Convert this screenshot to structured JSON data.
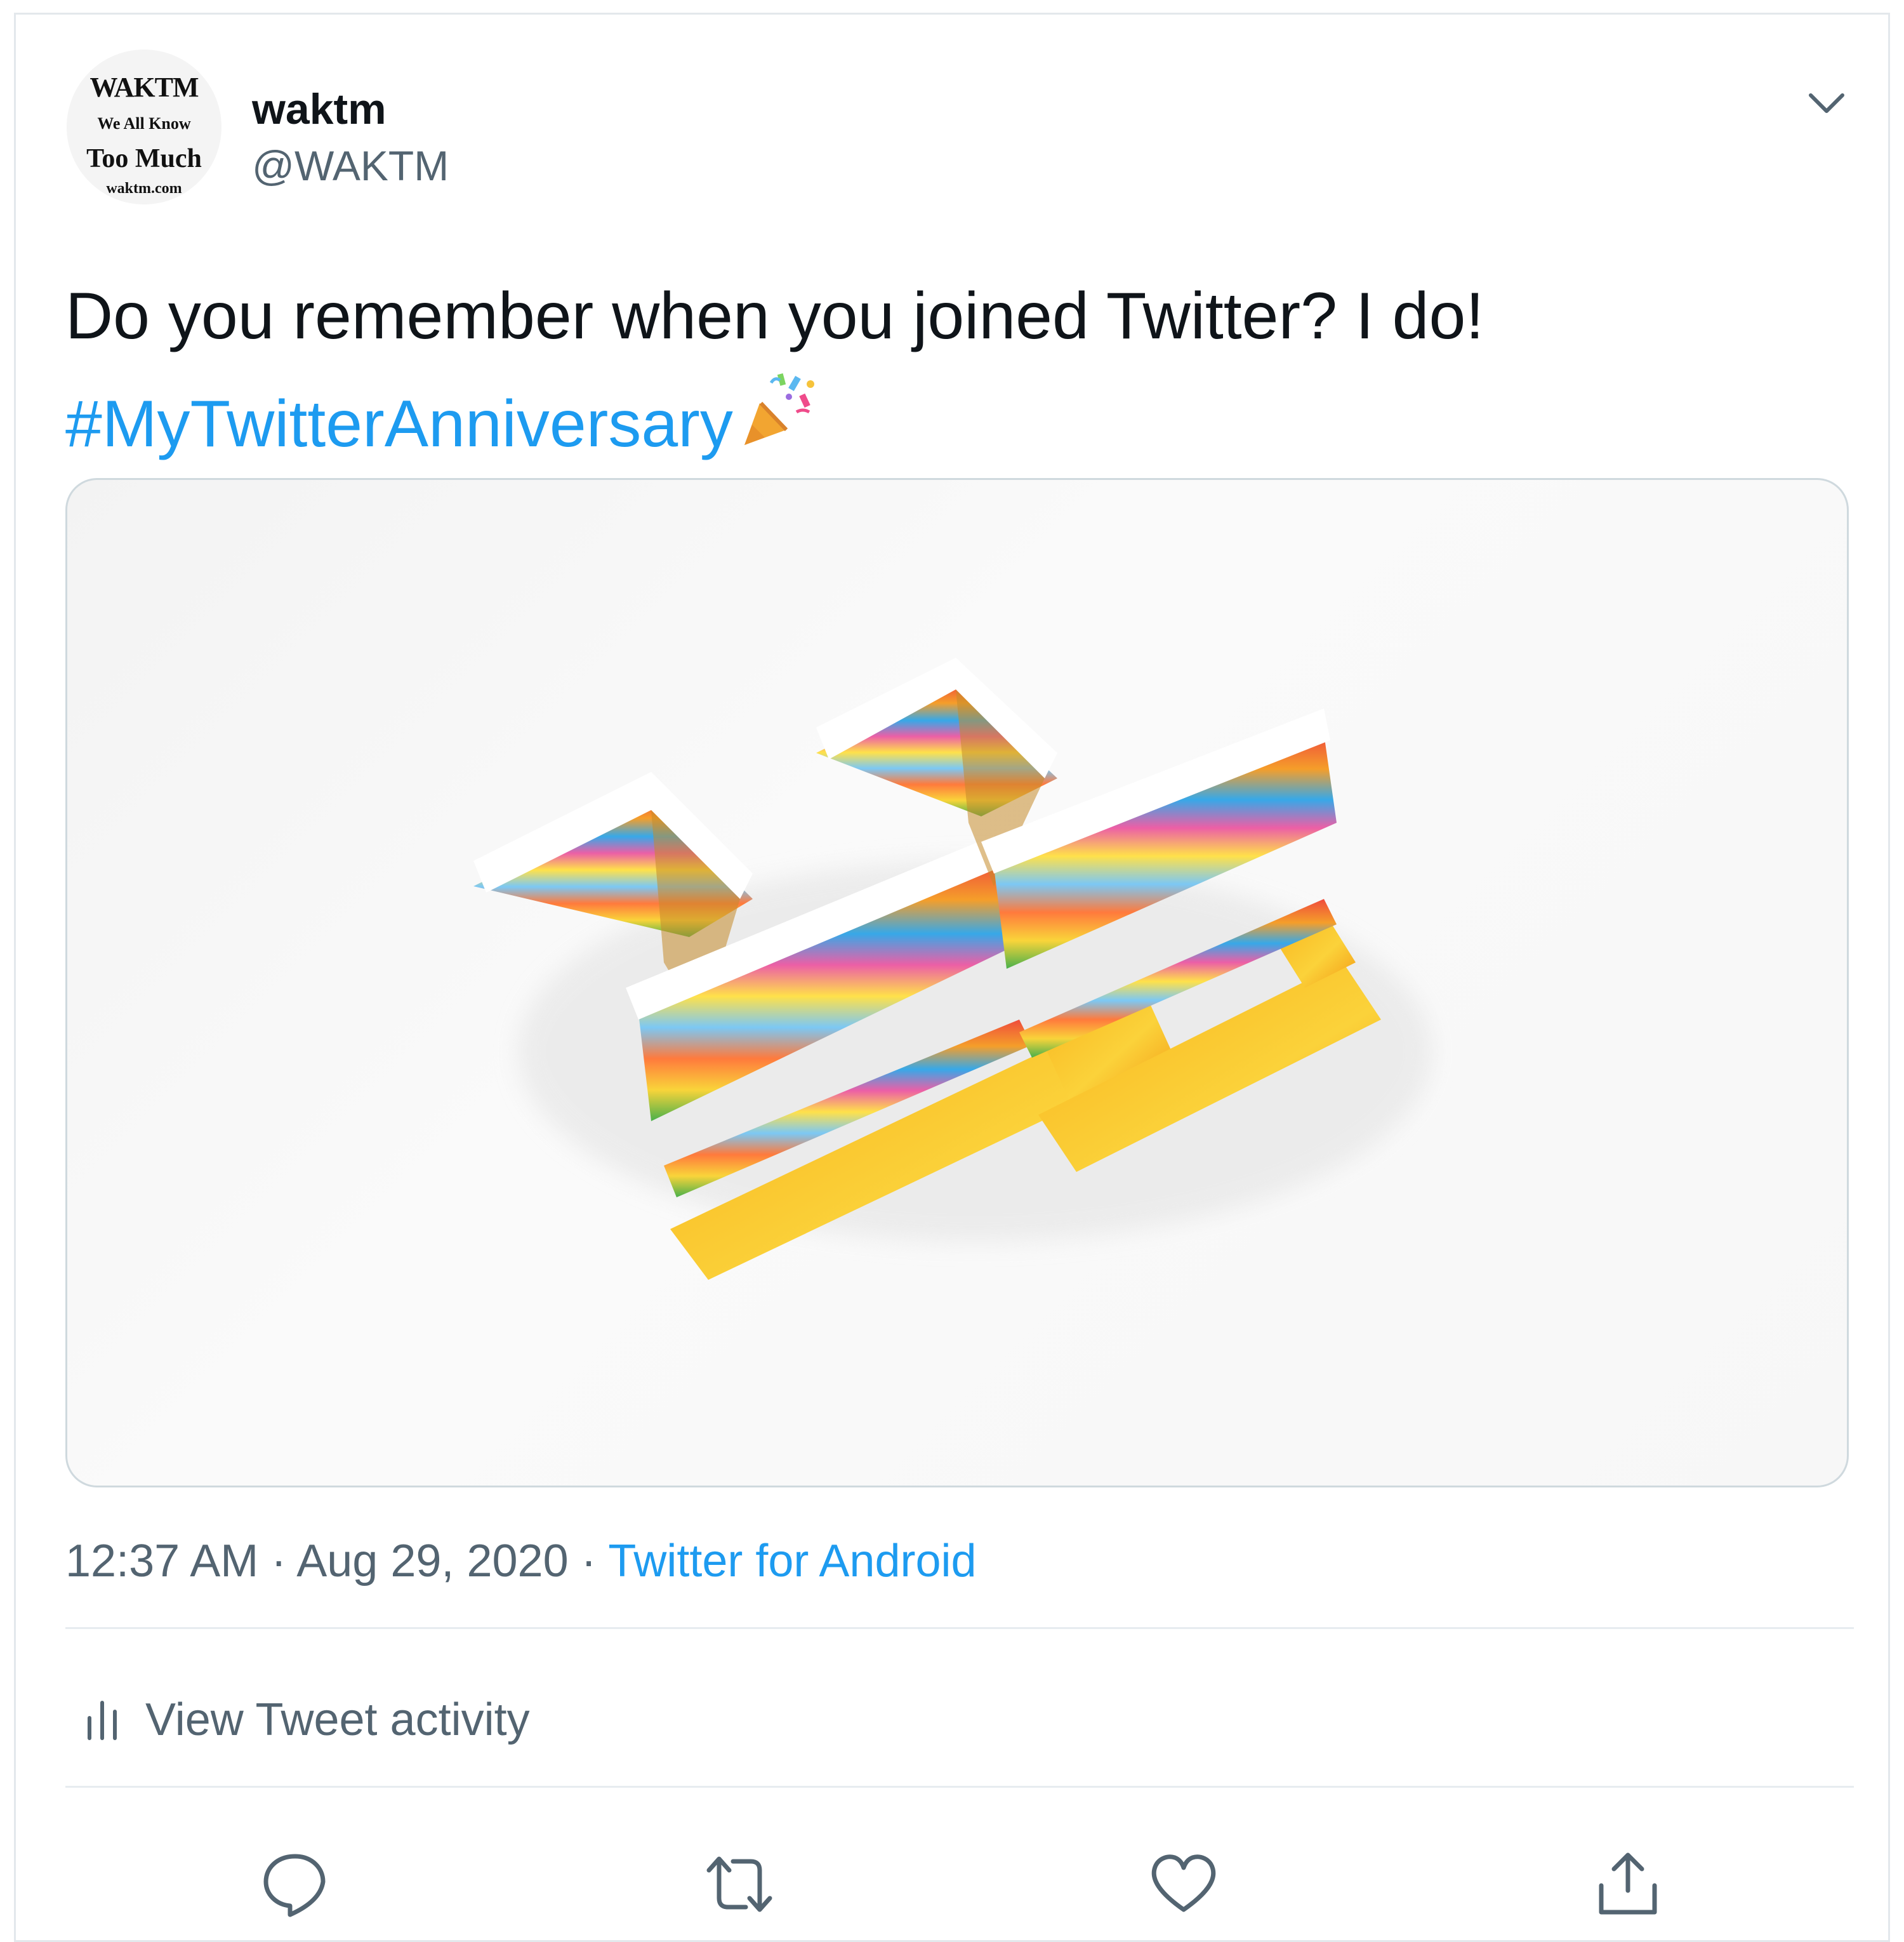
{
  "author": {
    "display_name": "waktm",
    "handle": "@WAKTM",
    "avatar_text": {
      "line1": "WAKTM",
      "line2": "We All Know",
      "line3": "Too Much",
      "line4": "waktm.com"
    }
  },
  "tweet": {
    "text": "Do you remember when you joined Twitter? I do!",
    "hashtag": "#MyTwitterAnniversary",
    "emoji_icon": "party-popper-icon"
  },
  "meta": {
    "time": "12:37 AM",
    "separator": " · ",
    "date": "Aug 29, 2020",
    "source": "Twitter for Android"
  },
  "activity": {
    "label": "View Tweet activity",
    "icon": "bar-chart-icon"
  },
  "actions": [
    {
      "name": "reply",
      "icon": "reply-icon"
    },
    {
      "name": "retweet",
      "icon": "retweet-icon"
    },
    {
      "name": "like",
      "icon": "heart-icon"
    },
    {
      "name": "share",
      "icon": "share-icon"
    }
  ],
  "colors": {
    "accent": "#1d9bf0",
    "text": "#0f1419",
    "muted": "#536471",
    "border": "#cfd9de"
  }
}
